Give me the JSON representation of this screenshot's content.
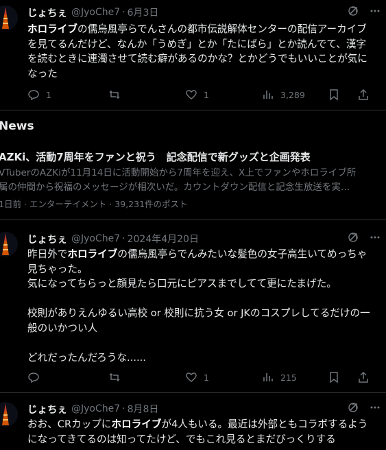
{
  "tweets": [
    {
      "name": "じょちぇ",
      "handle": "@JyoChe7",
      "date": "6月3日",
      "pre": "",
      "highlight": "ホロライブ",
      "post": "の儒烏風亭らでんさんの都市伝説解体センターの配信アーカイブ\nを見てるんだけど、なんか「うめぎ」とか「たにばら」とか読んでて、漢字\nを読むときに連濁させて読む癖があるのかな？とかどうでもいいことが気に\nなった",
      "replies": "1",
      "retweets": "",
      "likes": "1",
      "views": "3,289"
    },
    {
      "name": "じょちぇ",
      "handle": "@JyoChe7",
      "date": "2024年4月20日",
      "pre": "昨日外で",
      "highlight": "ホロライブ",
      "post": "の儒烏風亭らでんみたいな髪色の女子高生いてめっちゃ\n見ちゃった。\n気になってちらっと顔見たら口元にピアスまでしてて更にたまげた。\n\n校則がありえんゆるい高校 or 校則に抗う女 or JKのコスプレしてるだけの一\n般のいかつい人\n\nどれだったんだろうな......",
      "replies": "",
      "retweets": "",
      "likes": "1",
      "views": "215"
    },
    {
      "name": "じょちぇ",
      "handle": "@JyoChe7",
      "date": "8月8日",
      "pre": "おお、CRカップに",
      "highlight": "ホロライブ",
      "post": "が4人もいる。最近は外部ともコラボするよう\nになってきてるのは知ってたけど、でもこれ見るとまだびっくりする"
    }
  ],
  "news": {
    "section_title": "News",
    "headline": "AZKi、活動7周年をファンと祝う　記念配信で新グッズと企画発表",
    "summary_line1": "VTuberのAZKiが11月14日に活動開始から7周年を迎え、X上でファンやホロライブ所",
    "summary_line2": "属の仲間から祝福のメッセージが相次いだ。カウントダウン配信と記念生放送を実…",
    "meta": "1日前 · エンターテイメント · 39,231件のポスト"
  },
  "colors": {
    "background": "#000000",
    "text": "#e7e9ea",
    "muted": "#71767b",
    "divider": "#2f3336"
  }
}
